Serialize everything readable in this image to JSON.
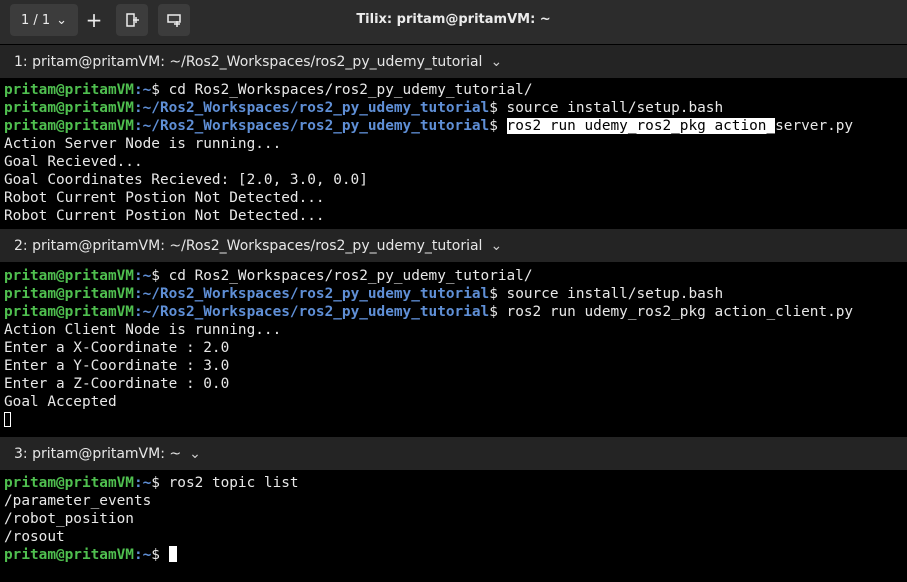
{
  "titlebar": {
    "session": "1 / 1",
    "title": "Tilix: pritam@pritamVM: ~"
  },
  "panes": [
    {
      "header": "1: pritam@pritamVM: ~/Ros2_Workspaces/ros2_py_udemy_tutorial",
      "lines": [
        {
          "user": "pritam@pritamVM",
          "path": ":~",
          "cmd": "$ cd Ros2_Workspaces/ros2_py_udemy_tutorial/"
        },
        {
          "user": "pritam@pritamVM",
          "path": ":~/Ros2_Workspaces/ros2_py_udemy_tutorial",
          "cmd": "$ source install/setup.bash"
        },
        {
          "user": "pritam@pritamVM",
          "path": ":~/Ros2_Workspaces/ros2_py_udemy_tutorial",
          "cmd": "$ ",
          "selected": "ros2 run udemy_ros2_pkg action_",
          "rest": "server.py"
        },
        {
          "text": "Action Server Node is running..."
        },
        {
          "text": "Goal Recieved..."
        },
        {
          "text": "Goal Coordinates Recieved: [2.0, 3.0, 0.0]"
        },
        {
          "text": "Robot Current Postion Not Detected..."
        },
        {
          "text": "Robot Current Postion Not Detected..."
        }
      ]
    },
    {
      "header": "2: pritam@pritamVM: ~/Ros2_Workspaces/ros2_py_udemy_tutorial",
      "lines": [
        {
          "user": "pritam@pritamVM",
          "path": ":~",
          "cmd": "$ cd Ros2_Workspaces/ros2_py_udemy_tutorial/"
        },
        {
          "user": "pritam@pritamVM",
          "path": ":~/Ros2_Workspaces/ros2_py_udemy_tutorial",
          "cmd": "$ source install/setup.bash"
        },
        {
          "user": "pritam@pritamVM",
          "path": ":~/Ros2_Workspaces/ros2_py_udemy_tutorial",
          "cmd": "$ ros2 run udemy_ros2_pkg action_client.py"
        },
        {
          "text": "Action Client Node is running..."
        },
        {
          "text": "Enter a X-Coordinate : 2.0"
        },
        {
          "text": "Enter a Y-Coordinate : 3.0"
        },
        {
          "text": "Enter a Z-Coordinate : 0.0"
        },
        {
          "text": "Goal Accepted"
        },
        {
          "cursor": "hollow"
        }
      ]
    },
    {
      "header": "3: pritam@pritamVM: ~",
      "lines": [
        {
          "user": "pritam@pritamVM",
          "path": ":~",
          "cmd": "$ ros2 topic list"
        },
        {
          "text": "/parameter_events"
        },
        {
          "text": "/robot_position"
        },
        {
          "text": "/rosout"
        },
        {
          "user": "pritam@pritamVM",
          "path": ":~",
          "cmd": "$ ",
          "cursor": "filled"
        }
      ]
    }
  ]
}
